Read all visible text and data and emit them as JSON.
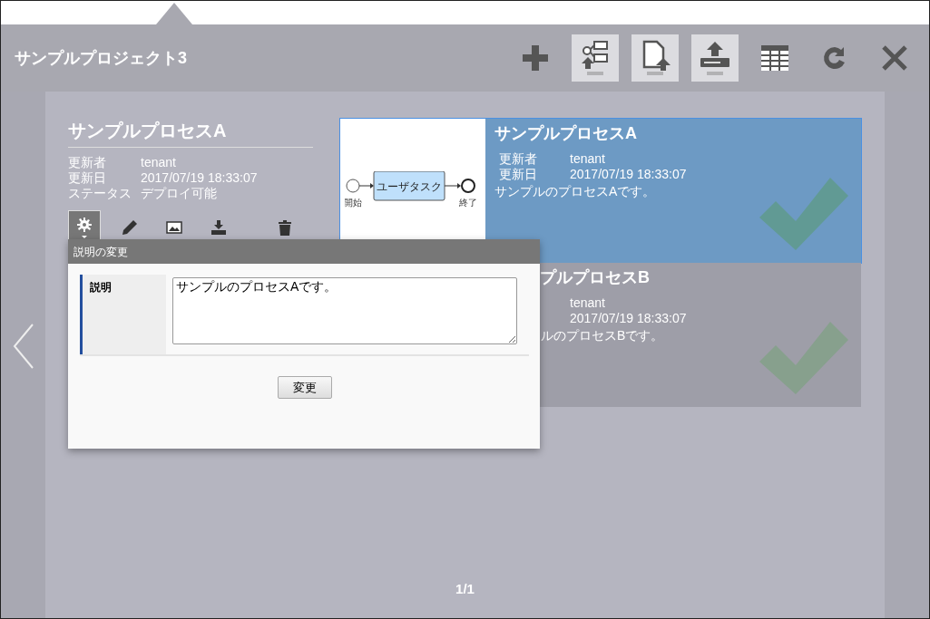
{
  "header": {
    "title": "サンプルプロジェクト3",
    "tools": [
      {
        "kind": "add",
        "framed": false
      },
      {
        "kind": "import-diagram",
        "framed": true
      },
      {
        "kind": "import-file",
        "framed": true
      },
      {
        "kind": "upload",
        "framed": true
      },
      {
        "kind": "table",
        "framed": false
      },
      {
        "kind": "refresh",
        "framed": false
      },
      {
        "kind": "close",
        "framed": false
      }
    ]
  },
  "detail": {
    "title": "サンプルプロセスA",
    "fields": [
      {
        "label": "更新者",
        "value": "tenant"
      },
      {
        "label": "更新日",
        "value": "2017/07/19 18:33:07"
      },
      {
        "label": "ステータス",
        "value": "デプロイ可能"
      }
    ],
    "actions": [
      {
        "kind": "settings",
        "selected": true
      },
      {
        "kind": "edit",
        "selected": false
      },
      {
        "kind": "image",
        "selected": false
      },
      {
        "kind": "download",
        "selected": false
      },
      {
        "kind": "delete",
        "selected": false
      }
    ]
  },
  "popup": {
    "title": "説明の変更",
    "rows": [
      {
        "label": "説明",
        "value": "サンプルのプロセスAです。"
      }
    ],
    "button": "変更"
  },
  "cards": [
    {
      "selected": true,
      "thumbnail": {
        "start": "開始",
        "task": "ユーザタスク",
        "end": "終了"
      },
      "title": "サンプルプロセスA",
      "fields": [
        {
          "label": "更新者",
          "value": "tenant"
        },
        {
          "label": "更新日",
          "value": "2017/07/19 18:33:07"
        }
      ],
      "description": "サンプルのプロセスAです。"
    },
    {
      "selected": false,
      "title": "プルプロセスB",
      "fields": [
        {
          "value": "tenant"
        },
        {
          "value": "2017/07/19 18:33:07"
        }
      ],
      "description": "ルのプロセスBです。"
    }
  ],
  "pager": "1/1"
}
